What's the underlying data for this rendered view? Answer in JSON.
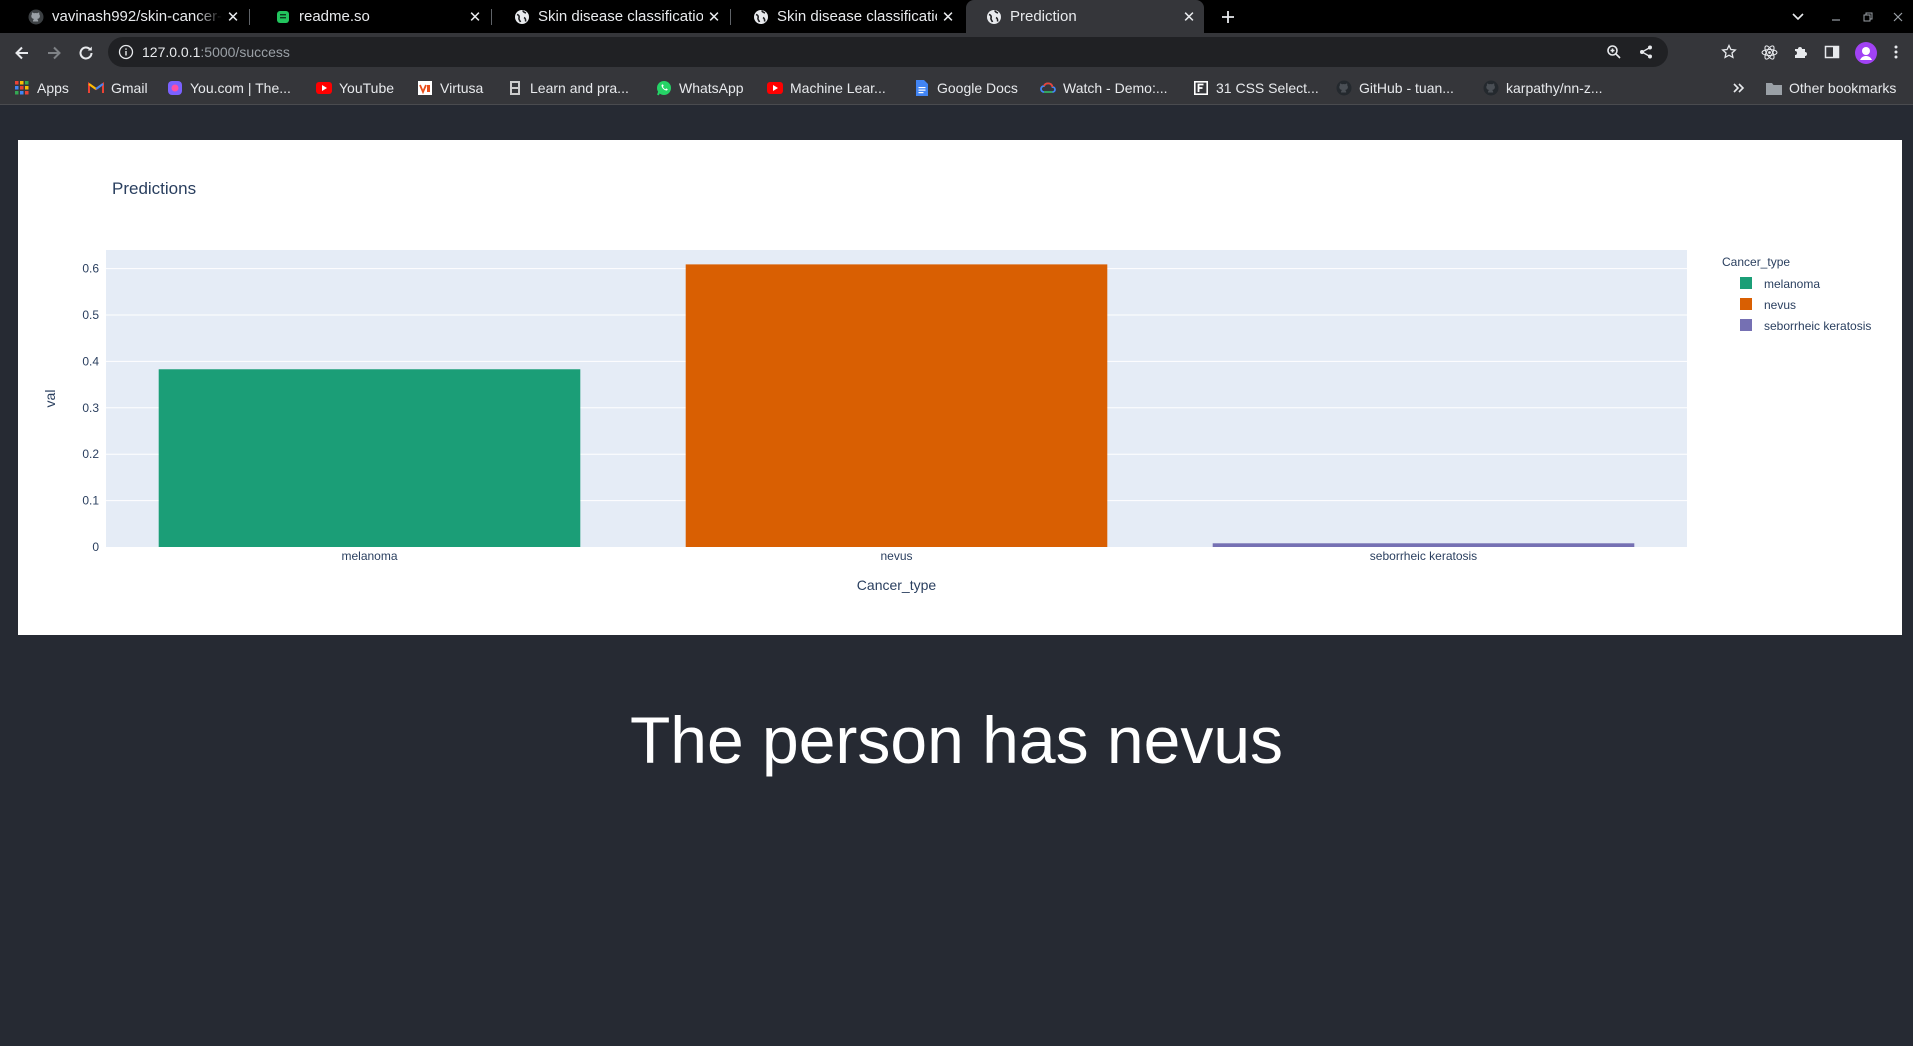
{
  "browser": {
    "tabs": [
      {
        "title": "vavinash992/skin-cancer-",
        "icon": "github-icon",
        "active": false
      },
      {
        "title": "readme.so",
        "icon": "readme-icon",
        "active": false
      },
      {
        "title": "Skin disease classification",
        "icon": "globe-icon",
        "active": false
      },
      {
        "title": "Skin disease classification",
        "icon": "globe-icon",
        "active": false
      },
      {
        "title": "Prediction",
        "icon": "globe-icon",
        "active": true
      }
    ],
    "url_host": "127.0.0.1",
    "url_rest": ":5000/success",
    "bookmarks": [
      {
        "label": "Apps",
        "icon": "apps-grid-icon",
        "color": "#4285f4"
      },
      {
        "label": "Gmail",
        "icon": "gmail-icon",
        "color": "#ea4335"
      },
      {
        "label": "You.com | The...",
        "icon": "youcom-icon",
        "color": "#7b61ff"
      },
      {
        "label": "YouTube",
        "icon": "youtube-icon",
        "color": "#ff0000"
      },
      {
        "label": "Virtusa",
        "icon": "virtusa-icon",
        "color": "#e94e1b"
      },
      {
        "label": "Learn and pra...",
        "icon": "hackerrank-icon",
        "color": "#cccccc"
      },
      {
        "label": "WhatsApp",
        "icon": "whatsapp-icon",
        "color": "#25d366"
      },
      {
        "label": "Machine Lear...",
        "icon": "youtube-icon",
        "color": "#ff0000"
      },
      {
        "label": "Google Docs",
        "icon": "docs-icon",
        "color": "#4285f4"
      },
      {
        "label": "Watch - Demo:...",
        "icon": "cloud-icon",
        "color": "#4285f4"
      },
      {
        "label": "31 CSS Select...",
        "icon": "bookmark-f-icon",
        "color": "#ffffff"
      },
      {
        "label": "GitHub - tuan...",
        "icon": "github-icon",
        "color": "#24292e"
      },
      {
        "label": "karpathy/nn-z...",
        "icon": "github-icon",
        "color": "#24292e"
      }
    ],
    "other_bookmarks": "Other bookmarks"
  },
  "chart_data": {
    "type": "bar",
    "title": "Predictions",
    "xlabel": "Cancer_type",
    "ylabel": "val",
    "categories": [
      "melanoma",
      "nevus",
      "seborrheic keratosis"
    ],
    "values": [
      0.383,
      0.609,
      0.008
    ],
    "colors": [
      "#1b9e77",
      "#d95f02",
      "#7570b3"
    ],
    "ylim": [
      0,
      0.64
    ],
    "yticks": [
      0,
      0.1,
      0.2,
      0.3,
      0.4,
      0.5,
      0.6
    ],
    "ytick_labels": [
      "0",
      "0.1",
      "0.2",
      "0.3",
      "0.4",
      "0.5",
      "0.6"
    ],
    "legend_title": "Cancer_type",
    "legend": [
      "melanoma",
      "nevus",
      "seborrheic keratosis"
    ],
    "legend_position": "right",
    "grid": true,
    "plot_bg": "#e5ecf6"
  },
  "result_text": "The person has nevus"
}
